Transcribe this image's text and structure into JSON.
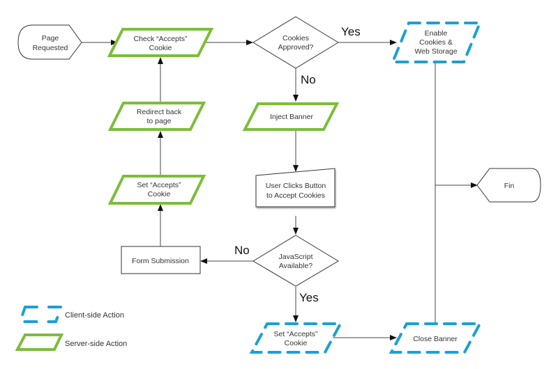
{
  "diagram": {
    "type": "flowchart",
    "colors": {
      "server_side": "#7cbd3a",
      "client_side": "#1aa0d8",
      "line": "#444444"
    },
    "nodes": {
      "page_requested": {
        "lines": [
          "Page",
          "Requested"
        ],
        "shape": "terminator-start"
      },
      "check_cookie": {
        "lines": [
          "Check “Accepts”",
          "Cookie"
        ],
        "shape": "parallelogram",
        "kind": "server-side"
      },
      "cookies_approved": {
        "lines": [
          "Cookies",
          "Approved?"
        ],
        "shape": "decision"
      },
      "enable_storage": {
        "lines": [
          "Enable",
          "Cookies &",
          "Web Storage"
        ],
        "shape": "parallelogram",
        "kind": "client-side"
      },
      "inject_banner": {
        "lines": [
          "Inject Banner"
        ],
        "shape": "parallelogram",
        "kind": "server-side"
      },
      "user_clicks": {
        "lines": [
          "User Clicks Button",
          "to Accept Cookies"
        ],
        "shape": "manual-input"
      },
      "js_available": {
        "lines": [
          "JavaScript",
          "Available?"
        ],
        "shape": "decision"
      },
      "form_submission": {
        "lines": [
          "Form Submission"
        ],
        "shape": "process"
      },
      "set_cookie_server": {
        "lines": [
          "Set “Accepts”",
          "Cookie"
        ],
        "shape": "parallelogram",
        "kind": "server-side"
      },
      "redirect_back": {
        "lines": [
          "Redirect back",
          "to page"
        ],
        "shape": "parallelogram",
        "kind": "server-side"
      },
      "set_cookie_client": {
        "lines": [
          "Set “Accepts”",
          "Cookie"
        ],
        "shape": "parallelogram",
        "kind": "client-side"
      },
      "close_banner": {
        "lines": [
          "Close Banner"
        ],
        "shape": "parallelogram",
        "kind": "client-side"
      },
      "fin": {
        "lines": [
          "Fin"
        ],
        "shape": "terminator-end"
      }
    },
    "edges": [
      {
        "from": "page_requested",
        "to": "check_cookie",
        "label": ""
      },
      {
        "from": "check_cookie",
        "to": "cookies_approved",
        "label": ""
      },
      {
        "from": "cookies_approved",
        "to": "enable_storage",
        "label": "Yes"
      },
      {
        "from": "cookies_approved",
        "to": "inject_banner",
        "label": "No"
      },
      {
        "from": "inject_banner",
        "to": "user_clicks",
        "label": ""
      },
      {
        "from": "user_clicks",
        "to": "js_available",
        "label": ""
      },
      {
        "from": "js_available",
        "to": "form_submission",
        "label": "No"
      },
      {
        "from": "js_available",
        "to": "set_cookie_client",
        "label": "Yes"
      },
      {
        "from": "form_submission",
        "to": "set_cookie_server",
        "label": ""
      },
      {
        "from": "set_cookie_server",
        "to": "redirect_back",
        "label": ""
      },
      {
        "from": "redirect_back",
        "to": "check_cookie",
        "label": ""
      },
      {
        "from": "set_cookie_client",
        "to": "close_banner",
        "label": ""
      },
      {
        "from": "enable_storage",
        "to": "fin",
        "label": ""
      },
      {
        "from": "close_banner",
        "to": "fin",
        "label": ""
      }
    ],
    "edge_labels": {
      "approved_yes": "Yes",
      "approved_no": "No",
      "js_no": "No",
      "js_yes": "Yes"
    },
    "legend": {
      "client": "Client-side Action",
      "server": "Server-side Action"
    }
  }
}
